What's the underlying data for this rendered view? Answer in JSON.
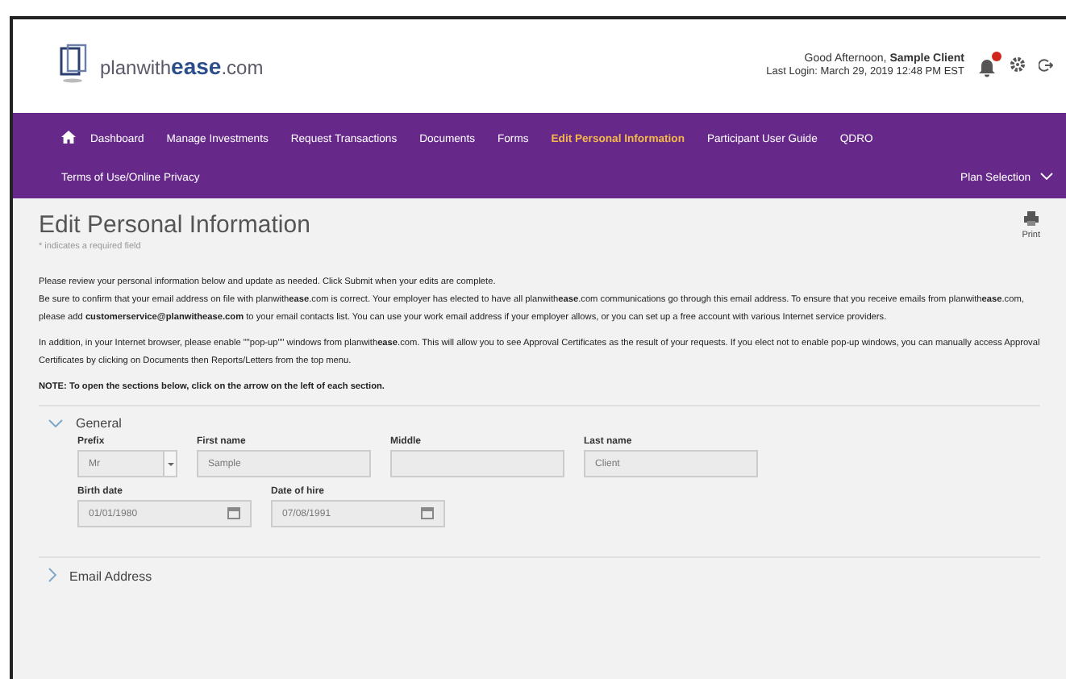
{
  "header": {
    "logo": "planwith**ease**.com",
    "greeting": "Good Afternoon, **Sample Client**",
    "last_login": "Last Login: March 29, 2019 12:48 PM EST",
    "notifications": {
      "unread": true
    }
  },
  "nav": {
    "items": [
      {
        "label": "Dashboard",
        "selected": false,
        "home": true
      },
      {
        "label": "Manage Investments",
        "selected": false
      },
      {
        "label": "Request Transactions",
        "selected": false
      },
      {
        "label": "Documents",
        "selected": false
      },
      {
        "label": "Forms",
        "selected": false
      },
      {
        "label": "Edit Personal Information",
        "selected": true
      },
      {
        "label": "Participant User Guide",
        "selected": false
      },
      {
        "label": "QDRO",
        "selected": false
      },
      {
        "label": "Terms of Use/Online Privacy",
        "selected": false
      }
    ],
    "plan_selection": "Plan Selection"
  },
  "page": {
    "title": "Edit Personal Information",
    "required_note": "* indicates a required field",
    "print": "Print",
    "paragraphs": [
      [
        "Please review your personal information below and update as needed. Click Submit when your edits are complete.",
        "Be sure to confirm that your email address on file with planwith**ease**.com is correct. Your employer has elected to have all planwith**ease**.com communications go through this email address. To ensure that you receive emails from planwith**ease**.com, please add **customerservice@planwithease.com** to your email contacts list. You can use your work email address if your employer allows, or you can set up a free account with various Internet service providers."
      ],
      [
        "In addition, in your Internet browser, please enable \"\"pop-up\"\" windows from planwith**ease**.com. This will allow you to see Approval Certificates as the result of your requests. If you elect not to enable pop-up windows, you can manually access Approval Certificates by clicking on Documents then Reports/Letters from the top menu."
      ],
      [
        "**NOTE: To open the sections below, click on the arrow on the left of each section.**"
      ]
    ]
  },
  "sections": [
    {
      "title": "General",
      "expanded": true,
      "rows": [
        [
          {
            "kind": "select",
            "label": "Prefix",
            "value": "Mr"
          },
          {
            "kind": "text",
            "label": "First name",
            "value": "Sample"
          },
          {
            "kind": "text",
            "label": "Middle"
          },
          {
            "kind": "text",
            "label": "Last name",
            "value": "Client"
          }
        ],
        [
          {
            "kind": "date",
            "label": "Birth date",
            "value": "01/01/1980"
          },
          {
            "kind": "date",
            "label": "Date of hire",
            "value": "07/08/1991"
          }
        ]
      ]
    },
    {
      "title": "Email Address",
      "expanded": false
    }
  ]
}
